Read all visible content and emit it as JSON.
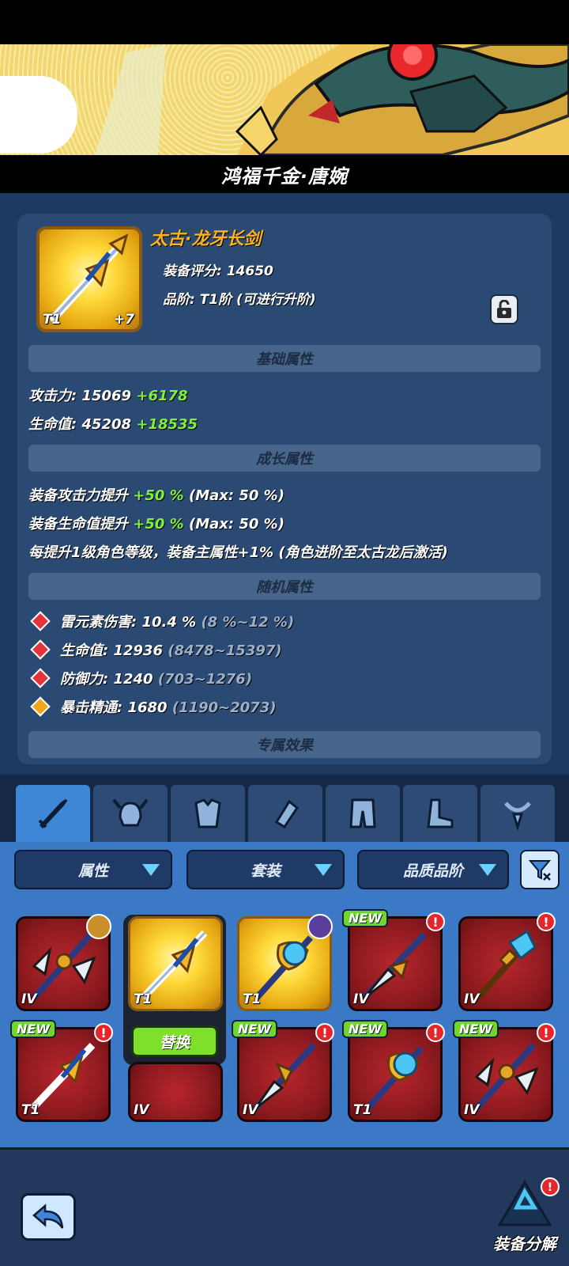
{
  "hero": {
    "name": "鸿福千金·唐婉"
  },
  "item": {
    "name": "太古·龙牙长剑",
    "tier_badge": "T1",
    "enhance": "+7",
    "score_line": "装备评分: 14650",
    "grade_line": "品阶: T1阶 (可进行升阶)"
  },
  "sections": {
    "base": "基础属性",
    "growth": "成长属性",
    "random": "随机属性",
    "exclusive": "专属效果"
  },
  "base_stats": [
    {
      "label": "攻击力: 15069 ",
      "bonus": "+6178"
    },
    {
      "label": "生命值: 45208 ",
      "bonus": "+18535"
    }
  ],
  "growth_stats": [
    {
      "label": "装备攻击力提升 ",
      "value": "+50 %",
      "max": " (Max: 50 %)"
    },
    {
      "label": "装备生命值提升 ",
      "value": "+50 %",
      "max": " (Max: 50 %)"
    },
    {
      "label": "每提升1级角色等级，装备主属性+1% (角色进阶至太古龙后激活)"
    }
  ],
  "random_stats": [
    {
      "label": "雷元素伤害: 10.4 % ",
      "range": "(8 %~12 %)",
      "gem": "red"
    },
    {
      "label": "生命值: 12936 ",
      "range": "(8478~15397)",
      "gem": "red"
    },
    {
      "label": "防御力: 1240 ",
      "range": "(703~1276)",
      "gem": "red"
    },
    {
      "label": "暴击精通: 1680 ",
      "range": "(1190~2073)",
      "gem": "gold"
    }
  ],
  "tabs": [
    "sword-icon",
    "helmet-icon",
    "armor-icon",
    "bracer-icon",
    "pants-icon",
    "boots-icon",
    "necklace-icon"
  ],
  "filters": {
    "attribute": "属性",
    "set": "套装",
    "quality": "品质品阶"
  },
  "inventory": {
    "row1": [
      {
        "tier": "IV",
        "new": false,
        "alert": false,
        "avatar": true
      },
      {
        "tier": "T1",
        "new": false,
        "alert": false,
        "avatar": false,
        "selected": true
      },
      {
        "tier": "T1",
        "new": false,
        "alert": false,
        "avatar": true
      },
      {
        "tier": "IV",
        "new": true,
        "alert": true
      },
      {
        "tier": "IV",
        "new": false,
        "alert": true
      }
    ],
    "row2": [
      {
        "tier": "T1",
        "new": true,
        "alert": true
      },
      {
        "tier": "IV",
        "new": false,
        "alert": false
      },
      {
        "tier": "IV",
        "new": true,
        "alert": true
      },
      {
        "tier": "T1",
        "new": true,
        "alert": true
      },
      {
        "tier": "IV",
        "new": true,
        "alert": true
      }
    ],
    "new_label": "NEW",
    "alert_label": "!",
    "replace_label": "替换"
  },
  "bottom": {
    "decompose_label": "装备分解"
  },
  "colors": {
    "accent_gold": "#ffb31a",
    "bonus_green": "#7ff03c",
    "panel": "#2a4a73"
  }
}
